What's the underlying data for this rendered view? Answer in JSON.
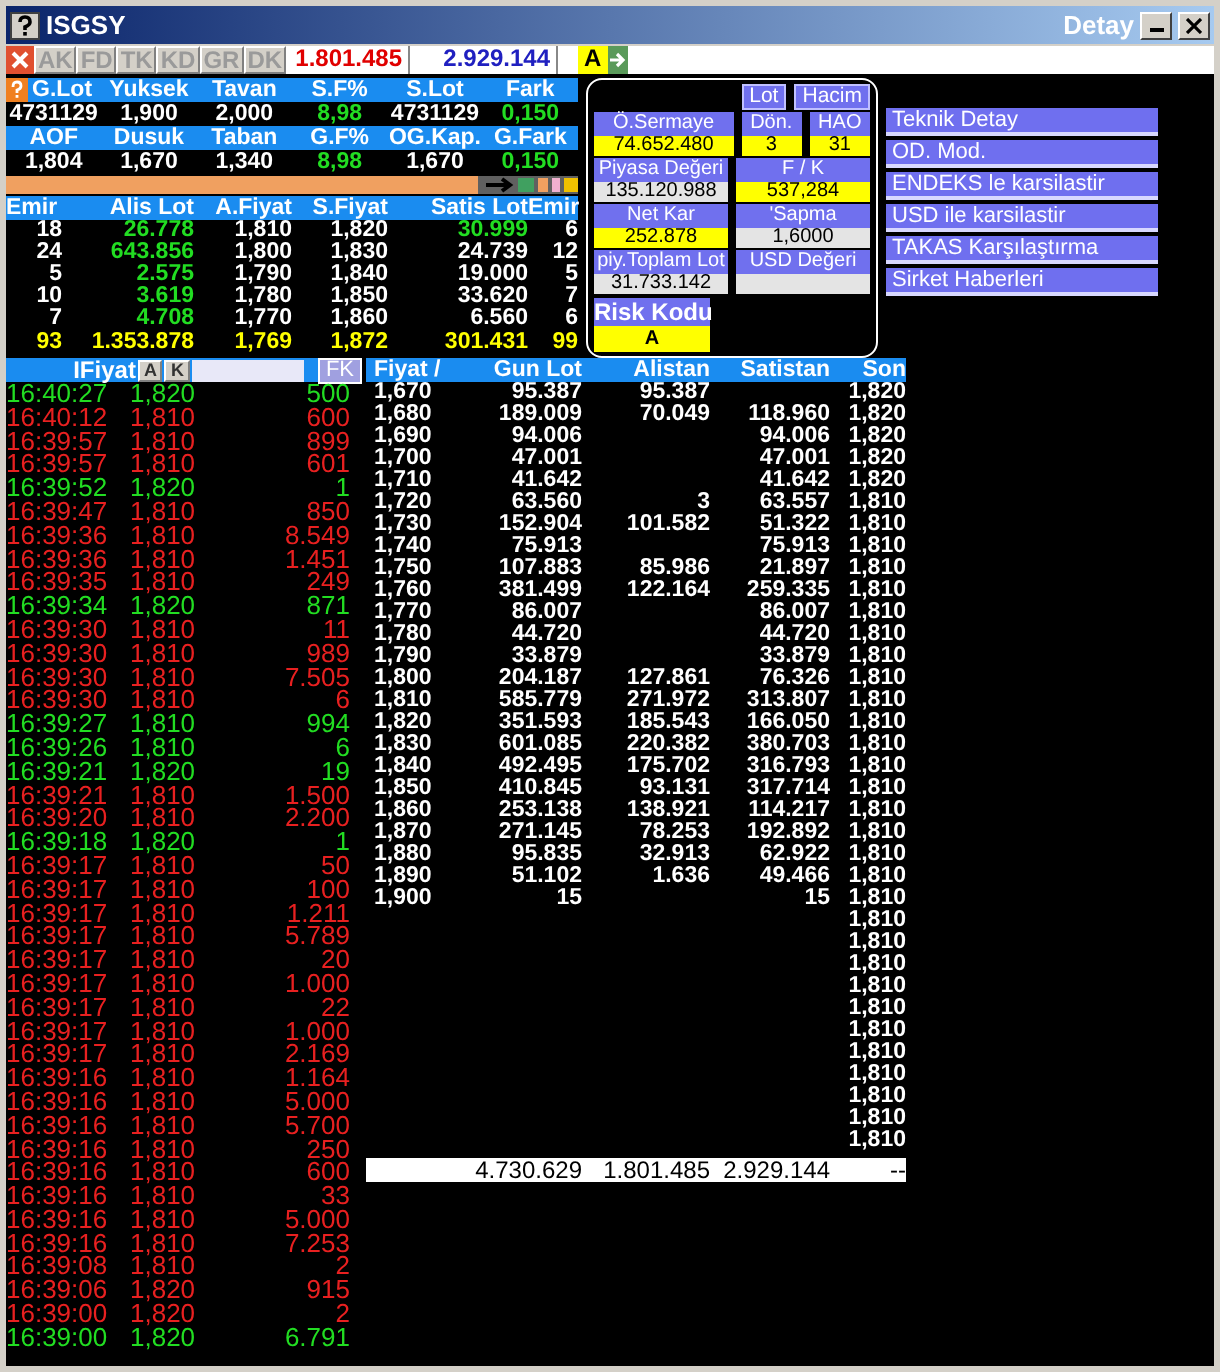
{
  "window": {
    "title": "ISGSY",
    "detail_title": "Detay"
  },
  "toolbar": {
    "tabs": [
      "AK",
      "FD",
      "TK",
      "KD",
      "GR",
      "DK"
    ],
    "bid_total": "1.801.485",
    "ask_total": "2.929.144",
    "risk": "A"
  },
  "stats": [
    {
      "headers": [
        "G.Lot",
        "Yuksek",
        "Tavan",
        "S.F%",
        "S.Lot",
        "Fark"
      ],
      "values": [
        {
          "text": "4731129",
          "highlight": false
        },
        {
          "text": "1,900",
          "highlight": false
        },
        {
          "text": "2,000",
          "highlight": false
        },
        {
          "text": "8,98",
          "highlight": true
        },
        {
          "text": "4731129",
          "highlight": false
        },
        {
          "text": "0,150",
          "highlight": true
        }
      ]
    },
    {
      "headers": [
        "AOF",
        "Dusuk",
        "Taban",
        "G.F%",
        "OG.Kap.",
        "G.Fark"
      ],
      "values": [
        {
          "text": "1,804",
          "highlight": false
        },
        {
          "text": "1,670",
          "highlight": false
        },
        {
          "text": "1,340",
          "highlight": false
        },
        {
          "text": "8,98",
          "highlight": true
        },
        {
          "text": "1,670",
          "highlight": false
        },
        {
          "text": "0,150",
          "highlight": true
        }
      ]
    }
  ],
  "depth": {
    "columns": [
      "Emir",
      "Alis Lot",
      "A.Fiyat",
      "S.Fiyat",
      "Satis Lot",
      "Emir"
    ],
    "rows": [
      {
        "kind": "level",
        "cells": [
          {
            "text": "18",
            "highlight": false
          },
          {
            "text": "26.778",
            "highlight": true
          },
          {
            "text": "1,810",
            "highlight": false
          },
          {
            "text": "1,820",
            "highlight": false
          },
          {
            "text": "30.999",
            "highlight": true
          },
          {
            "text": "6",
            "highlight": false
          }
        ]
      },
      {
        "kind": "level",
        "cells": [
          {
            "text": "24",
            "highlight": false
          },
          {
            "text": "643.856",
            "highlight": true
          },
          {
            "text": "1,800",
            "highlight": false
          },
          {
            "text": "1,830",
            "highlight": false
          },
          {
            "text": "24.739",
            "highlight": false
          },
          {
            "text": "12",
            "highlight": false
          }
        ]
      },
      {
        "kind": "level",
        "cells": [
          {
            "text": "5",
            "highlight": false
          },
          {
            "text": "2.575",
            "highlight": true
          },
          {
            "text": "1,790",
            "highlight": false
          },
          {
            "text": "1,840",
            "highlight": false
          },
          {
            "text": "19.000",
            "highlight": false
          },
          {
            "text": "5",
            "highlight": false
          }
        ]
      },
      {
        "kind": "level",
        "cells": [
          {
            "text": "10",
            "highlight": false
          },
          {
            "text": "3.619",
            "highlight": true
          },
          {
            "text": "1,780",
            "highlight": false
          },
          {
            "text": "1,850",
            "highlight": false
          },
          {
            "text": "33.620",
            "highlight": false
          },
          {
            "text": "7",
            "highlight": false
          }
        ]
      },
      {
        "kind": "level",
        "cells": [
          {
            "text": "7",
            "highlight": false
          },
          {
            "text": "4.708",
            "highlight": true
          },
          {
            "text": "1,770",
            "highlight": false
          },
          {
            "text": "1,860",
            "highlight": false
          },
          {
            "text": "6.560",
            "highlight": false
          },
          {
            "text": "6",
            "highlight": false
          }
        ]
      },
      {
        "kind": "total",
        "cells": [
          {
            "text": "93"
          },
          {
            "text": "1.353.878"
          },
          {
            "text": "1,769"
          },
          {
            "text": "1,872"
          },
          {
            "text": "301.431"
          },
          {
            "text": "99"
          }
        ]
      }
    ]
  },
  "detail": {
    "buttons": [
      "Lot",
      "Hacim"
    ],
    "rows": [
      [
        {
          "label": "Ö.Sermaye",
          "value": "74.652.480",
          "color": "#ffff00"
        },
        {
          "label": "Dön.",
          "value": "3",
          "color": "#ffff00"
        },
        {
          "label": "HAO",
          "value": "31",
          "color": "#ffff00"
        }
      ],
      [
        {
          "label": "Piyasa Değeri",
          "value": "135.120.988",
          "color": "#e4e4e4"
        },
        {
          "label": "F / K",
          "value": "537,284",
          "color": "#ffff00"
        }
      ],
      [
        {
          "label": "Net Kar",
          "value": "252.878",
          "color": "#ffff00"
        },
        {
          "label": "'Sapma",
          "value": "1,6000",
          "color": "#e4e4e4"
        }
      ],
      [
        {
          "label": "piy.Toplam Lot",
          "value": "31.733.142",
          "color": "#e4e4e4"
        },
        {
          "label": "USD Değeri",
          "color": "#e4e4e4"
        }
      ]
    ],
    "risk": {
      "label": "Risk Kodu",
      "value": "A"
    }
  },
  "actions": [
    "Teknik Detay",
    "OD. Mod.",
    "ENDEKS le karsilastir",
    "USD ile karsilastir",
    "TAKAS Karşılaştırma",
    "Sirket Haberleri"
  ],
  "trades": {
    "header": "IFiyat",
    "buttons": [
      "A",
      "K"
    ],
    "filter_button": "FK",
    "rows": [
      {
        "time": "16:40:27",
        "price": "1,820",
        "lot": "500",
        "up": true
      },
      {
        "time": "16:40:12",
        "price": "1,810",
        "lot": "600",
        "up": false
      },
      {
        "time": "16:39:57",
        "price": "1,810",
        "lot": "899",
        "up": false
      },
      {
        "time": "16:39:57",
        "price": "1,810",
        "lot": "601",
        "up": false
      },
      {
        "time": "16:39:52",
        "price": "1,820",
        "lot": "1",
        "up": true
      },
      {
        "time": "16:39:47",
        "price": "1,810",
        "lot": "850",
        "up": false
      },
      {
        "time": "16:39:36",
        "price": "1,810",
        "lot": "8.549",
        "up": false
      },
      {
        "time": "16:39:36",
        "price": "1,810",
        "lot": "1.451",
        "up": false
      },
      {
        "time": "16:39:35",
        "price": "1,810",
        "lot": "249",
        "up": false
      },
      {
        "time": "16:39:34",
        "price": "1,820",
        "lot": "871",
        "up": true
      },
      {
        "time": "16:39:30",
        "price": "1,810",
        "lot": "11",
        "up": false
      },
      {
        "time": "16:39:30",
        "price": "1,810",
        "lot": "989",
        "up": false
      },
      {
        "time": "16:39:30",
        "price": "1,810",
        "lot": "7.505",
        "up": false
      },
      {
        "time": "16:39:30",
        "price": "1,810",
        "lot": "6",
        "up": false
      },
      {
        "time": "16:39:27",
        "price": "1,810",
        "lot": "994",
        "up": true
      },
      {
        "time": "16:39:26",
        "price": "1,810",
        "lot": "6",
        "up": true
      },
      {
        "time": "16:39:21",
        "price": "1,820",
        "lot": "19",
        "up": true
      },
      {
        "time": "16:39:21",
        "price": "1,810",
        "lot": "1.500",
        "up": false
      },
      {
        "time": "16:39:20",
        "price": "1,810",
        "lot": "2.200",
        "up": false
      },
      {
        "time": "16:39:18",
        "price": "1,820",
        "lot": "1",
        "up": true
      },
      {
        "time": "16:39:17",
        "price": "1,810",
        "lot": "50",
        "up": false
      },
      {
        "time": "16:39:17",
        "price": "1,810",
        "lot": "100",
        "up": false
      },
      {
        "time": "16:39:17",
        "price": "1,810",
        "lot": "1.211",
        "up": false
      },
      {
        "time": "16:39:17",
        "price": "1,810",
        "lot": "5.789",
        "up": false
      },
      {
        "time": "16:39:17",
        "price": "1,810",
        "lot": "20",
        "up": false
      },
      {
        "time": "16:39:17",
        "price": "1,810",
        "lot": "1.000",
        "up": false
      },
      {
        "time": "16:39:17",
        "price": "1,810",
        "lot": "22",
        "up": false
      },
      {
        "time": "16:39:17",
        "price": "1,810",
        "lot": "1.000",
        "up": false
      },
      {
        "time": "16:39:17",
        "price": "1,810",
        "lot": "2.169",
        "up": false
      },
      {
        "time": "16:39:16",
        "price": "1,810",
        "lot": "1.164",
        "up": false
      },
      {
        "time": "16:39:16",
        "price": "1,810",
        "lot": "5.000",
        "up": false
      },
      {
        "time": "16:39:16",
        "price": "1,810",
        "lot": "5.700",
        "up": false
      },
      {
        "time": "16:39:16",
        "price": "1,810",
        "lot": "250",
        "up": false
      },
      {
        "time": "16:39:16",
        "price": "1,810",
        "lot": "600",
        "up": false
      },
      {
        "time": "16:39:16",
        "price": "1,810",
        "lot": "33",
        "up": false
      },
      {
        "time": "16:39:16",
        "price": "1,810",
        "lot": "5.000",
        "up": false
      },
      {
        "time": "16:39:16",
        "price": "1,810",
        "lot": "7.253",
        "up": false
      },
      {
        "time": "16:39:08",
        "price": "1,810",
        "lot": "2",
        "up": false
      },
      {
        "time": "16:39:06",
        "price": "1,820",
        "lot": "915",
        "up": false
      },
      {
        "time": "16:39:00",
        "price": "1,820",
        "lot": "2",
        "up": false
      },
      {
        "time": "16:39:00",
        "price": "1,820",
        "lot": "6.791",
        "up": true
      }
    ]
  },
  "prices": {
    "columns": [
      "Fiyat /",
      "Gun Lot",
      "Alistan",
      "Satistan",
      "Son"
    ],
    "rows": [
      {
        "fiyat": "1,670",
        "gun_lot": "95.387",
        "alistan": "95.387",
        "son": "1,820"
      },
      {
        "fiyat": "1,680",
        "gun_lot": "189.009",
        "alistan": "70.049",
        "satistan": "118.960",
        "son": "1,820"
      },
      {
        "fiyat": "1,690",
        "gun_lot": "94.006",
        "satistan": "94.006",
        "son": "1,820"
      },
      {
        "fiyat": "1,700",
        "gun_lot": "47.001",
        "satistan": "47.001",
        "son": "1,820"
      },
      {
        "fiyat": "1,710",
        "gun_lot": "41.642",
        "satistan": "41.642",
        "son": "1,820"
      },
      {
        "fiyat": "1,720",
        "gun_lot": "63.560",
        "alistan": "3",
        "satistan": "63.557",
        "son": "1,810"
      },
      {
        "fiyat": "1,730",
        "gun_lot": "152.904",
        "alistan": "101.582",
        "satistan": "51.322",
        "son": "1,810"
      },
      {
        "fiyat": "1,740",
        "gun_lot": "75.913",
        "satistan": "75.913",
        "son": "1,810"
      },
      {
        "fiyat": "1,750",
        "gun_lot": "107.883",
        "alistan": "85.986",
        "satistan": "21.897",
        "son": "1,810"
      },
      {
        "fiyat": "1,760",
        "gun_lot": "381.499",
        "alistan": "122.164",
        "satistan": "259.335",
        "son": "1,810"
      },
      {
        "fiyat": "1,770",
        "gun_lot": "86.007",
        "satistan": "86.007",
        "son": "1,810"
      },
      {
        "fiyat": "1,780",
        "gun_lot": "44.720",
        "satistan": "44.720",
        "son": "1,810"
      },
      {
        "fiyat": "1,790",
        "gun_lot": "33.879",
        "satistan": "33.879",
        "son": "1,810"
      },
      {
        "fiyat": "1,800",
        "gun_lot": "204.187",
        "alistan": "127.861",
        "satistan": "76.326",
        "son": "1,810"
      },
      {
        "fiyat": "1,810",
        "gun_lot": "585.779",
        "alistan": "271.972",
        "satistan": "313.807",
        "son": "1,810"
      },
      {
        "fiyat": "1,820",
        "gun_lot": "351.593",
        "alistan": "185.543",
        "satistan": "166.050",
        "son": "1,810"
      },
      {
        "fiyat": "1,830",
        "gun_lot": "601.085",
        "alistan": "220.382",
        "satistan": "380.703",
        "son": "1,810"
      },
      {
        "fiyat": "1,840",
        "gun_lot": "492.495",
        "alistan": "175.702",
        "satistan": "316.793",
        "son": "1,810"
      },
      {
        "fiyat": "1,850",
        "gun_lot": "410.845",
        "alistan": "93.131",
        "satistan": "317.714",
        "son": "1,810"
      },
      {
        "fiyat": "1,860",
        "gun_lot": "253.138",
        "alistan": "138.921",
        "satistan": "114.217",
        "son": "1,810"
      },
      {
        "fiyat": "1,870",
        "gun_lot": "271.145",
        "alistan": "78.253",
        "satistan": "192.892",
        "son": "1,810"
      },
      {
        "fiyat": "1,880",
        "gun_lot": "95.835",
        "alistan": "32.913",
        "satistan": "62.922",
        "son": "1,810"
      },
      {
        "fiyat": "1,890",
        "gun_lot": "51.102",
        "alistan": "1.636",
        "satistan": "49.466",
        "son": "1,810"
      },
      {
        "fiyat": "1,900",
        "gun_lot": "15",
        "satistan": "15",
        "son": "1,810"
      },
      {
        "son": "1,810"
      },
      {
        "son": "1,810"
      },
      {
        "son": "1,810"
      },
      {
        "son": "1,810"
      },
      {
        "son": "1,810"
      },
      {
        "son": "1,810"
      },
      {
        "son": "1,810"
      },
      {
        "son": "1,810"
      },
      {
        "son": "1,810"
      },
      {
        "son": "1,810"
      },
      {
        "son": "1,810"
      }
    ],
    "total": {
      "gun_lot": "4.730.629",
      "alistan": "1.801.485",
      "satistan": "2.929.144",
      "son": "--"
    }
  }
}
